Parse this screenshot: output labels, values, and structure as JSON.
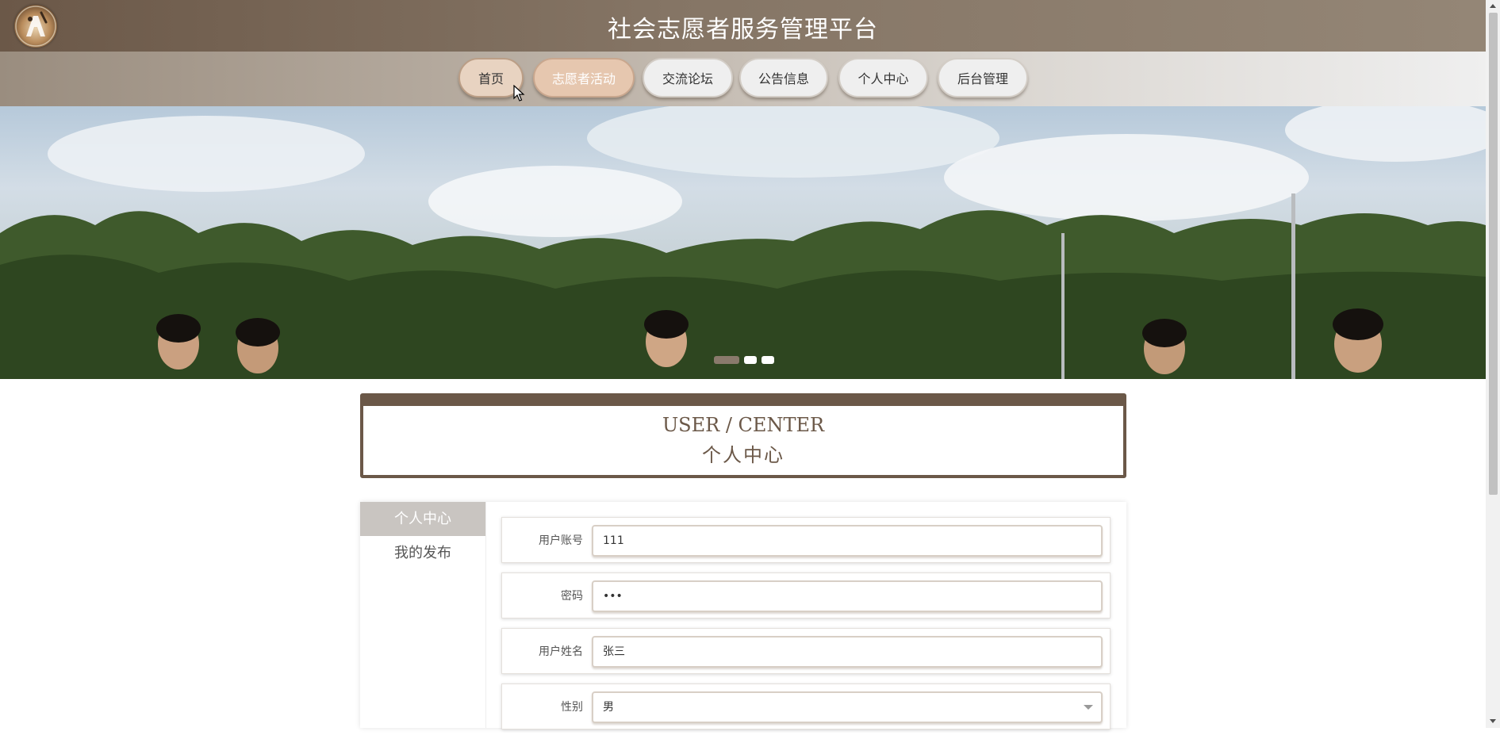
{
  "site": {
    "title": "社会志愿者服务管理平台",
    "logo": "volunteer-logo"
  },
  "nav": {
    "items": [
      {
        "label": "首页",
        "state": "active"
      },
      {
        "label": "志愿者活动",
        "state": "hover"
      },
      {
        "label": "交流论坛",
        "state": "normal"
      },
      {
        "label": "公告信息",
        "state": "normal"
      },
      {
        "label": "个人中心",
        "state": "normal"
      },
      {
        "label": "后台管理",
        "state": "normal"
      }
    ]
  },
  "banner": {
    "image": "volunteers-group-outdoor-photo",
    "slide_count": 3,
    "current_slide": 1
  },
  "section": {
    "title_en": "USER / CENTER",
    "title_cn": "个人中心"
  },
  "sidebar": {
    "items": [
      {
        "label": "个人中心",
        "active": true
      },
      {
        "label": "我的发布",
        "active": false
      }
    ]
  },
  "form": {
    "fields": [
      {
        "label": "用户账号",
        "value": "111",
        "type": "text"
      },
      {
        "label": "密码",
        "value": "•••",
        "type": "password"
      },
      {
        "label": "用户姓名",
        "value": "张三",
        "type": "text"
      },
      {
        "label": "性别",
        "value": "男",
        "type": "select"
      }
    ]
  },
  "colors": {
    "brand": "#6b5848",
    "nav_active": "#e8d3c1",
    "nav_hover": "#e6c7af",
    "sidebar_active": "#c9c5c1"
  }
}
